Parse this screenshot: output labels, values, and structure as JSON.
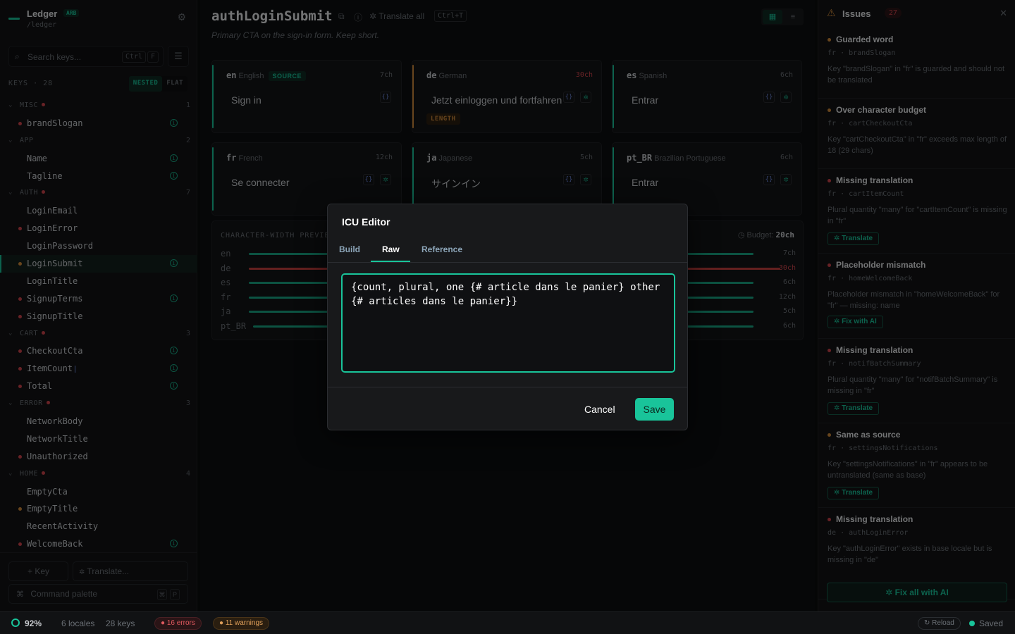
{
  "sidebar": {
    "brand_name": "Ledger",
    "brand_badge": "ARB",
    "brand_path": "/ledger",
    "search_placeholder": "Search keys...",
    "search_kbd_1": "Ctrl",
    "search_kbd_2": "F",
    "keys_label": "KEYS · 28",
    "view_nested": "NESTED",
    "view_flat": "FLAT",
    "tree": [
      {
        "kind": "group",
        "name": "MISC",
        "err": true,
        "count": "1"
      },
      {
        "kind": "key",
        "name": "brandSlogan",
        "dot": "#d0454c",
        "info": true
      },
      {
        "kind": "group",
        "name": "APP",
        "err": false,
        "count": "2"
      },
      {
        "kind": "key",
        "name": "Name",
        "dot": "",
        "info": true
      },
      {
        "kind": "key",
        "name": "Tagline",
        "dot": "",
        "info": true
      },
      {
        "kind": "group",
        "name": "AUTH",
        "err": true,
        "count": "7"
      },
      {
        "kind": "key",
        "name": "LoginEmail",
        "dot": "",
        "info": false
      },
      {
        "kind": "key",
        "name": "LoginError",
        "dot": "#d0454c",
        "info": false
      },
      {
        "kind": "key",
        "name": "LoginPassword",
        "dot": "",
        "info": false
      },
      {
        "kind": "key",
        "name": "LoginSubmit",
        "dot": "#d08a3a",
        "info": true,
        "selected": true
      },
      {
        "kind": "key",
        "name": "LoginTitle",
        "dot": "",
        "info": false
      },
      {
        "kind": "key",
        "name": "SignupTerms",
        "dot": "#d0454c",
        "info": true
      },
      {
        "kind": "key",
        "name": "SignupTitle",
        "dot": "#d0454c",
        "info": false
      },
      {
        "kind": "group",
        "name": "CART",
        "err": true,
        "count": "3"
      },
      {
        "kind": "key",
        "name": "CheckoutCta",
        "dot": "#d0454c",
        "info": true
      },
      {
        "kind": "key",
        "name": "ItemCount",
        "dot": "#d0454c",
        "info": true,
        "bar": true
      },
      {
        "kind": "key",
        "name": "Total",
        "dot": "#d0454c",
        "info": true
      },
      {
        "kind": "group",
        "name": "ERROR",
        "err": true,
        "count": "3"
      },
      {
        "kind": "key",
        "name": "NetworkBody",
        "dot": "",
        "info": false
      },
      {
        "kind": "key",
        "name": "NetworkTitle",
        "dot": "",
        "info": false
      },
      {
        "kind": "key",
        "name": "Unauthorized",
        "dot": "#d0454c",
        "info": false
      },
      {
        "kind": "group",
        "name": "HOME",
        "err": true,
        "count": "4"
      },
      {
        "kind": "key",
        "name": "EmptyCta",
        "dot": "",
        "info": false
      },
      {
        "kind": "key",
        "name": "EmptyTitle",
        "dot": "#d08a3a",
        "info": false
      },
      {
        "kind": "key",
        "name": "RecentActivity",
        "dot": "",
        "info": false
      },
      {
        "kind": "key",
        "name": "WelcomeBack",
        "dot": "#d0454c",
        "info": true
      }
    ],
    "add_key": "+ Key",
    "translate": "Translate...",
    "command_palette": "Command palette",
    "cmd_kbd_1": "⌘",
    "cmd_kbd_2": "P"
  },
  "main": {
    "title": "authLoginSubmit",
    "translate_all": "Translate all",
    "translate_kbd": "Ctrl+T",
    "description": "Primary CTA on the sign-in form. Keep short.",
    "cards": [
      {
        "code": "en",
        "name": "English",
        "source": "SOURCE",
        "chars": "7ch",
        "chars_color": "#6b7076",
        "value": "Sign in",
        "accent": "#19c49a",
        "length_tag": "",
        "ai": false
      },
      {
        "code": "de",
        "name": "German",
        "source": "",
        "chars": "30ch",
        "chars_color": "#d0454c",
        "value": "Jetzt einloggen und fortfahren",
        "accent": "#d08a3a",
        "length_tag": "LENGTH",
        "ai": true
      },
      {
        "code": "es",
        "name": "Spanish",
        "source": "",
        "chars": "6ch",
        "chars_color": "#6b7076",
        "value": "Entrar",
        "accent": "#19c49a",
        "length_tag": "",
        "ai": true
      },
      {
        "code": "fr",
        "name": "French",
        "source": "",
        "chars": "12ch",
        "chars_color": "#6b7076",
        "value": "Se connecter",
        "accent": "#19c49a",
        "length_tag": "",
        "ai": true
      },
      {
        "code": "ja",
        "name": "Japanese",
        "source": "",
        "chars": "5ch",
        "chars_color": "#6b7076",
        "value": "サインイン",
        "accent": "#19c49a",
        "length_tag": "",
        "ai": true
      },
      {
        "code": "pt_BR",
        "name": "Brazilian Portuguese",
        "source": "",
        "chars": "6ch",
        "chars_color": "#6b7076",
        "value": "Entrar",
        "accent": "#19c49a",
        "length_tag": "",
        "ai": true
      }
    ],
    "cw_title": "CHARACTER-WIDTH PREVIEW",
    "cw_budget_label": "Budget:",
    "cw_budget_value": "20ch",
    "cw_rows": [
      {
        "code": "en",
        "chars": 7,
        "label": "7ch",
        "color": "#19a784",
        "over": false
      },
      {
        "code": "de",
        "chars": 30,
        "label": "30ch",
        "color": "#c8413f",
        "over": true
      },
      {
        "code": "es",
        "chars": 6,
        "label": "6ch",
        "color": "#19a784",
        "over": false
      },
      {
        "code": "fr",
        "chars": 12,
        "label": "12ch",
        "color": "#19a784",
        "over": false
      },
      {
        "code": "ja",
        "chars": 5,
        "label": "5ch",
        "color": "#19a784",
        "over": false
      },
      {
        "code": "pt_BR",
        "chars": 6,
        "label": "6ch",
        "color": "#19a784",
        "over": false
      }
    ]
  },
  "issues": {
    "title": "Issues",
    "count": "27",
    "items": [
      {
        "title": "Guarded word",
        "dot": "#d08a3a",
        "locale": "fr",
        "key": "brandSlogan",
        "desc": "Key \"brandSlogan\" in \"fr\" is guarded and should not be translated",
        "action": ""
      },
      {
        "title": "Over character budget",
        "dot": "#d08a3a",
        "locale": "fr",
        "key": "cartCheckoutCta",
        "desc": "Key \"cartCheckoutCta\" in \"fr\" exceeds max length of 18 (29 chars)",
        "action": ""
      },
      {
        "title": "Missing translation",
        "dot": "#d0454c",
        "locale": "fr",
        "key": "cartItemCount",
        "desc": "Plural quantity \"many\" for \"cartItemCount\" is missing in \"fr\"",
        "action": "Translate"
      },
      {
        "title": "Placeholder mismatch",
        "dot": "#d0454c",
        "locale": "fr",
        "key": "homeWelcomeBack",
        "desc": "Placeholder mismatch in \"homeWelcomeBack\" for \"fr\" — missing: name",
        "action": "Fix with AI"
      },
      {
        "title": "Missing translation",
        "dot": "#d0454c",
        "locale": "fr",
        "key": "notifBatchSummary",
        "desc": "Plural quantity \"many\" for \"notifBatchSummary\" is missing in \"fr\"",
        "action": "Translate"
      },
      {
        "title": "Same as source",
        "dot": "#d08a3a",
        "locale": "fr",
        "key": "settingsNotifications",
        "desc": "Key \"settingsNotifications\" in \"fr\" appears to be untranslated (same as base)",
        "action": "Translate"
      },
      {
        "title": "Missing translation",
        "dot": "#d0454c",
        "locale": "de",
        "key": "authLoginError",
        "desc": "Key \"authLoginError\" exists in base locale but is missing in \"de\"",
        "action": ""
      }
    ],
    "fix_all": "Fix all with AI"
  },
  "status": {
    "coverage": "92%",
    "locales": "6 locales",
    "keys": "28 keys",
    "errors": "16 errors",
    "warnings": "11 warnings",
    "reload": "Reload",
    "saved": "Saved"
  },
  "modal": {
    "title": "ICU Editor",
    "tab_build": "Build",
    "tab_raw": "Raw",
    "tab_reference": "Reference",
    "value": "{count, plural, one {# article dans le panier} other {# articles dans le panier}}",
    "cancel": "Cancel",
    "save": "Save"
  },
  "colors": {
    "accent": "#19c49a",
    "error": "#d0454c",
    "warning": "#d08a3a"
  }
}
